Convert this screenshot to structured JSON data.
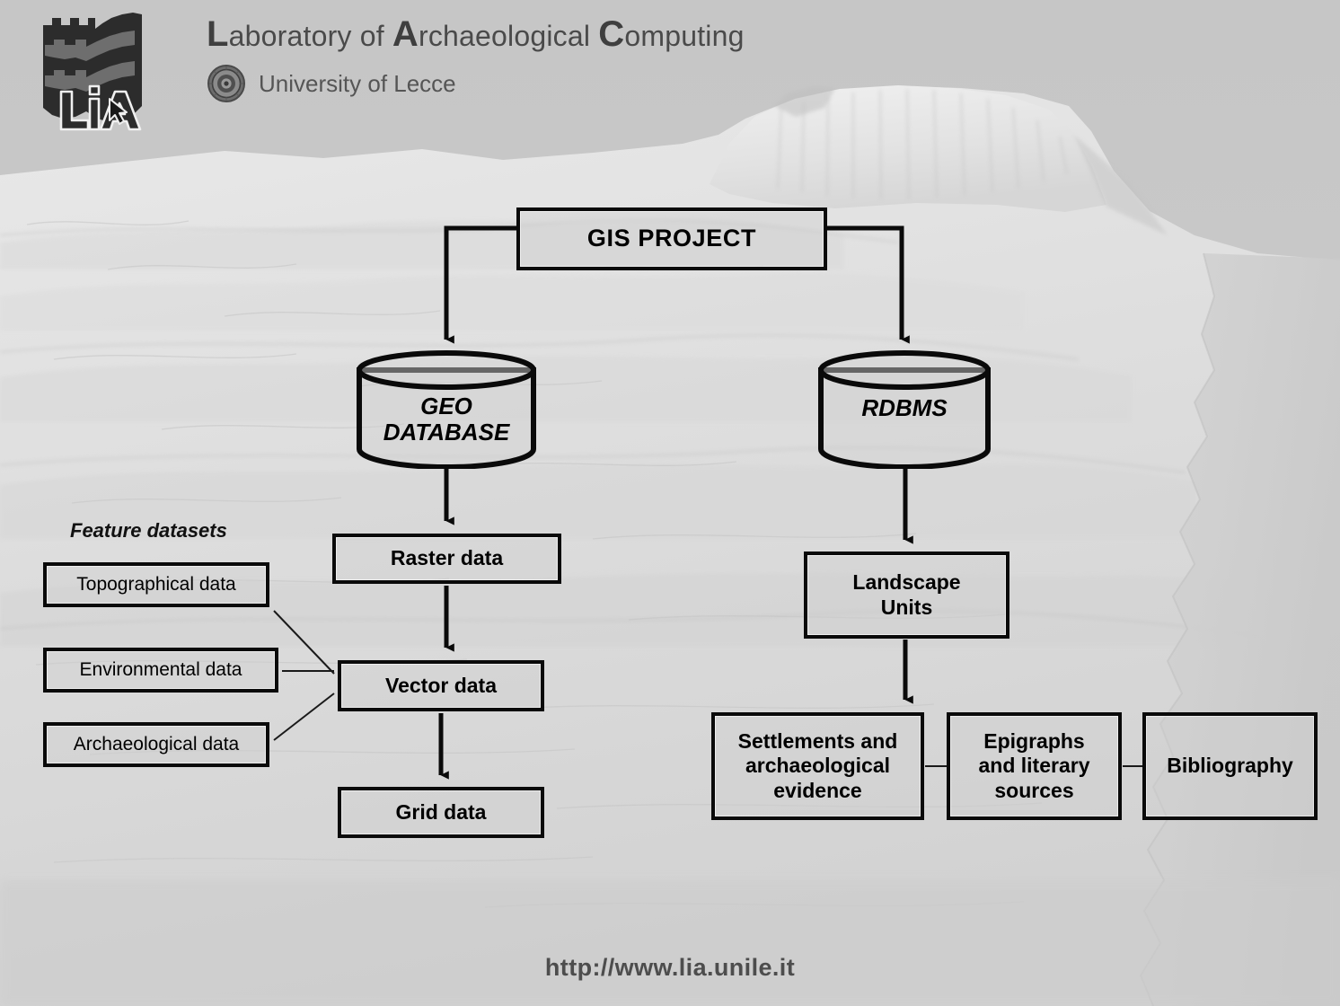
{
  "header": {
    "title_parts": [
      {
        "cap": "L",
        "rest": "aboratory of "
      },
      {
        "cap": "A",
        "rest": "rchaeological "
      },
      {
        "cap": "C",
        "rest": "omputing"
      }
    ],
    "title_full": "Laboratory of Archaeological Computing",
    "subtitle": "University of Lecce",
    "logo_icon": "lia-castle-logo-icon",
    "seal_icon": "university-seal-icon"
  },
  "diagram": {
    "root": {
      "label": "GIS PROJECT"
    },
    "databases": [
      {
        "id": "geo-database",
        "label": "GEO\nDATABASE",
        "line1": "GEO",
        "line2": "DATABASE"
      },
      {
        "id": "rdbms",
        "label": "RDBMS",
        "line1": "RDBMS",
        "line2": ""
      }
    ],
    "left_branch": {
      "group_label": "Feature datasets",
      "feature_datasets": [
        {
          "id": "topographical-data",
          "label": "Topographical data"
        },
        {
          "id": "environmental-data",
          "label": "Environmental data"
        },
        {
          "id": "archaeological-data",
          "label": "Archaeological data"
        }
      ],
      "chain": [
        {
          "id": "raster-data",
          "label": "Raster data"
        },
        {
          "id": "vector-data",
          "label": "Vector data"
        },
        {
          "id": "grid-data",
          "label": "Grid data"
        }
      ]
    },
    "right_branch": {
      "landscape_units": {
        "id": "landscape-units",
        "line1": "Landscape",
        "line2": "Units",
        "label": "Landscape Units"
      },
      "tables": [
        {
          "id": "settlements",
          "line1": "Settlements and",
          "line2": "archaeological",
          "line3": "evidence",
          "label": "Settlements and archaeological evidence"
        },
        {
          "id": "epigraphs",
          "line1": "Epigraphs",
          "line2": "and literary",
          "line3": "sources",
          "label": "Epigraphs and literary sources"
        },
        {
          "id": "bibliography",
          "line1": "Bibliography",
          "line2": "",
          "line3": "",
          "label": "Bibliography"
        }
      ]
    }
  },
  "footer": {
    "url": "http://www.lia.unile.it"
  },
  "colors": {
    "stroke": "#0a0a0a",
    "box_fill": "rgba(208,208,208,0.40)",
    "text": "#000000",
    "header_text": "#4a4a4a",
    "footer_text": "#4d4d4d",
    "background": "#cacaca"
  }
}
